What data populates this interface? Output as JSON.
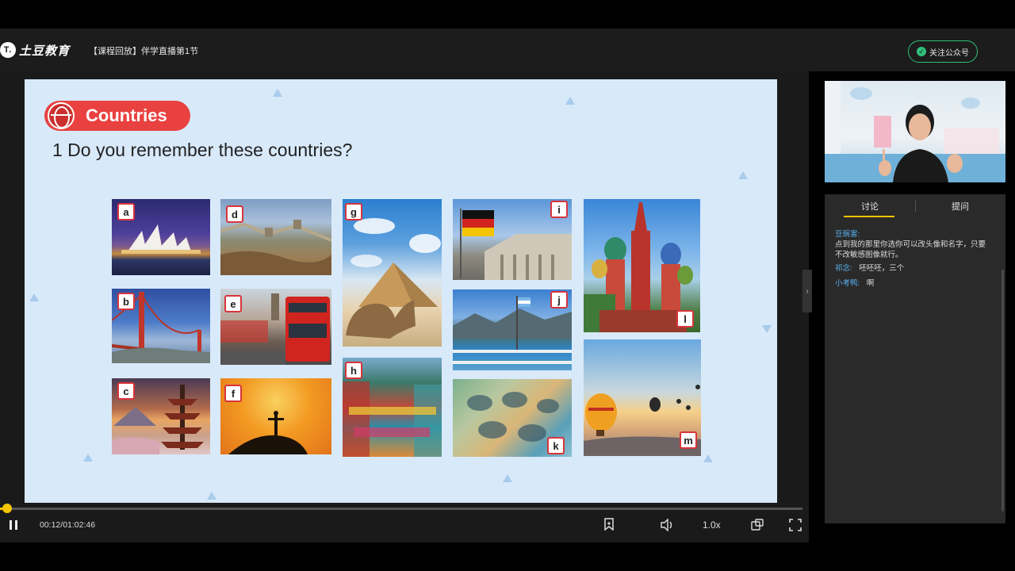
{
  "header": {
    "logo_mark": "T.",
    "logo_text": "土豆教育",
    "course_title": "【课程回放】伴学直播第1节",
    "follow_label": "关注公众号"
  },
  "slide": {
    "section_title": "Countries",
    "question": "1 Do you remember these countries?",
    "photos": [
      {
        "tag": "a",
        "subject": "Sydney Opera House"
      },
      {
        "tag": "b",
        "subject": "Golden Gate Bridge"
      },
      {
        "tag": "c",
        "subject": "Mount Fuji pagoda"
      },
      {
        "tag": "d",
        "subject": "Great Wall"
      },
      {
        "tag": "e",
        "subject": "London red bus"
      },
      {
        "tag": "f",
        "subject": "Christ the Redeemer"
      },
      {
        "tag": "g",
        "subject": "Pyramid and camel"
      },
      {
        "tag": "h",
        "subject": "Colorful street"
      },
      {
        "tag": "i",
        "subject": "German flag Reichstag"
      },
      {
        "tag": "j",
        "subject": "Argentina lake"
      },
      {
        "tag": "k",
        "subject": "Casa Batllo"
      },
      {
        "tag": "l",
        "subject": "Saint Basil's Cathedral"
      },
      {
        "tag": "m",
        "subject": "Hot air balloons"
      }
    ]
  },
  "player": {
    "time": "00:12/01:02:46",
    "progress_fraction": 0.0032,
    "speed": "1.0x"
  },
  "panel": {
    "tab_discuss": "讨论",
    "tab_ask": "提问",
    "messages": [
      {
        "name": "豆豌害:",
        "text": "点到我的那里你选你可以改头像和名字，只要不改敏感图像就行。"
      },
      {
        "name": "祁念:",
        "text": "呸呸呸，三个"
      },
      {
        "name": "小考鸭:",
        "text": "啊"
      }
    ]
  },
  "icons": {
    "pause": "pause-icon",
    "bookmark": "bookmark-icon",
    "volume": "volume-icon",
    "pip": "picture-in-picture-icon",
    "fullscreen": "fullscreen-icon",
    "collapse": "chevron-right-icon",
    "globe": "globe-icon",
    "verified": "check-circle-icon"
  },
  "colors": {
    "accent_yellow": "#f5c400",
    "brand_green": "#2fc07a",
    "pill_red": "#e8413f",
    "slide_bg": "#d8e9fa",
    "name_blue": "#5ab0ee"
  }
}
